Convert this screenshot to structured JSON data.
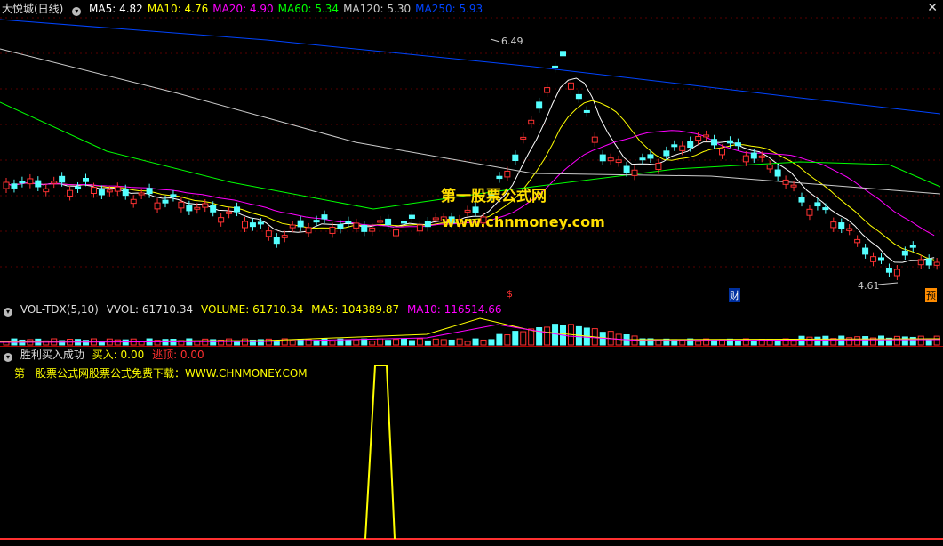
{
  "main": {
    "title": "大悦城(日线)",
    "ma": [
      {
        "label": "MA5: 4.82",
        "color": "#ffffff"
      },
      {
        "label": "MA10: 4.76",
        "color": "#ffff00"
      },
      {
        "label": "MA20: 4.90",
        "color": "#ff00ff"
      },
      {
        "label": "MA60: 5.34",
        "color": "#00ff00"
      },
      {
        "label": "MA120: 5.30",
        "color": "#cccccc"
      },
      {
        "label": "MA250: 5.93",
        "color": "#0044ff"
      }
    ],
    "high_label": "6.49",
    "low_label": "4.61",
    "marker_s": "$",
    "marker_cai": "财",
    "marker_yu": "预",
    "watermark": "第一股票公式网",
    "watermark_url": "www.chnmoney.com"
  },
  "volume": {
    "indicator": "VOL-TDX(5,10)",
    "vvol": "VVOL: 61710.34",
    "volume": "VOLUME: 61710.34",
    "ma5": "MA5: 104389.87",
    "ma10": "MA10: 116514.66"
  },
  "signal": {
    "name": "胜利买入成功",
    "buy": "买入: 0.00",
    "escape": "逃顶: 0.00",
    "promo": "第一股票公式网股票公式免费下载：WWW.CHNMONEY.COM"
  },
  "colors": {
    "up": "#ff3232",
    "down": "#54ffff",
    "axis": "#b00000",
    "signal_line": "#ffff00"
  },
  "icons": {
    "collapse": "circle-chevron-icon",
    "close": "close-icon"
  }
}
